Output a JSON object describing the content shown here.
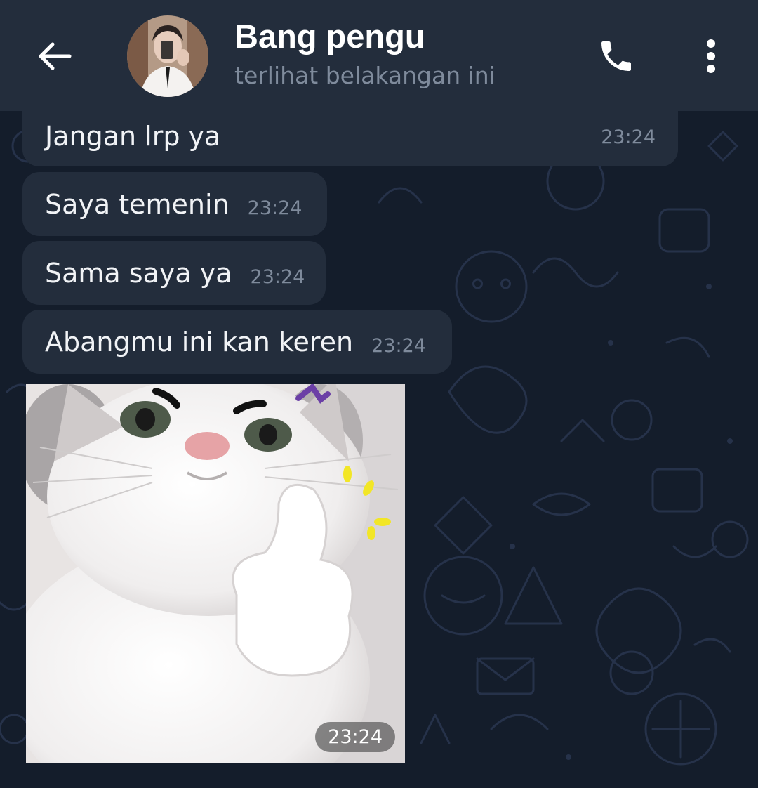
{
  "header": {
    "contact_name": "Bang pengu",
    "status": "terlihat belakangan ini",
    "back_icon": "arrow-left-icon",
    "call_icon": "phone-icon",
    "menu_icon": "more-vertical-icon"
  },
  "messages": [
    {
      "text": "Jangan lrp ya",
      "time": "23:24"
    },
    {
      "text": "Saya temenin",
      "time": "23:24"
    },
    {
      "text": "Sama saya ya",
      "time": "23:24"
    },
    {
      "text": "Abangmu ini kan keren",
      "time": "23:24"
    }
  ],
  "photo_message": {
    "time": "23:24",
    "description_icon": "cat-thumbs-up-sticker-photo"
  },
  "colors": {
    "header_bg": "#232d3c",
    "chat_bg": "#141d2b",
    "bubble_bg": "#232d3c",
    "text": "#f1f3f6",
    "muted_text": "#7f8b9c"
  }
}
